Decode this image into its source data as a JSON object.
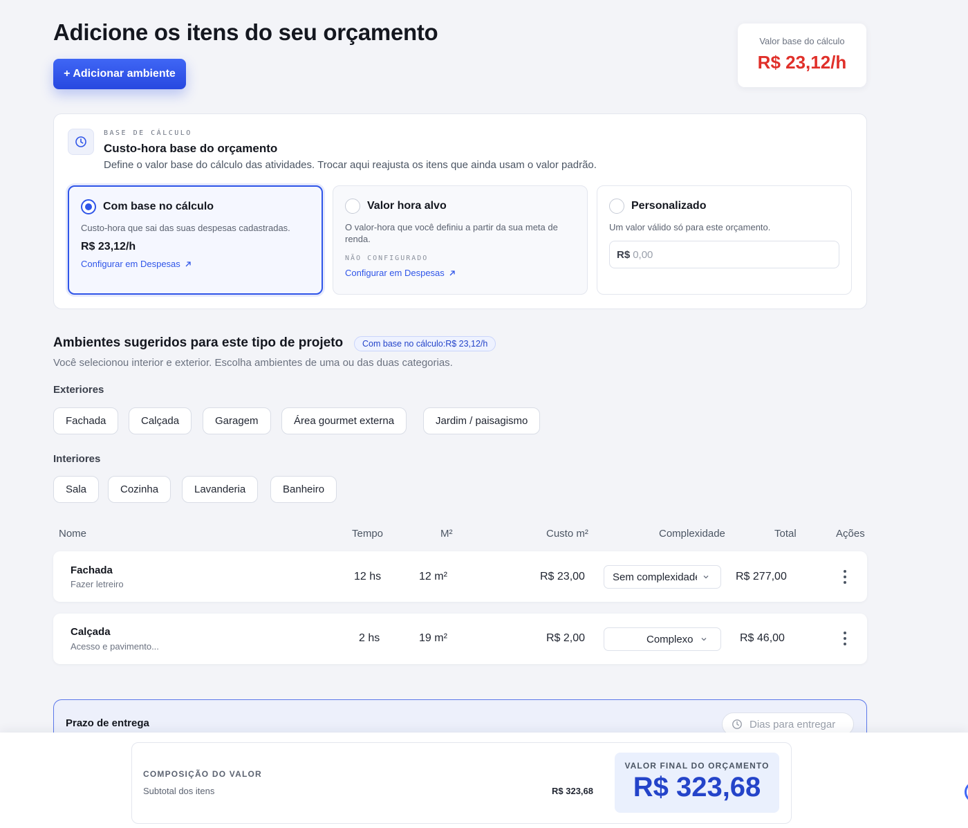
{
  "header": {
    "title": "Adicione os itens do seu orçamento",
    "add_button": "+ Adicionar ambiente",
    "base_card": {
      "label": "Valor base do cálculo",
      "value": "R$ 23,12/h"
    }
  },
  "calc_panel": {
    "eyebrow": "BASE DE CÁLCULO",
    "title": "Custo-hora base do orçamento",
    "description": "Define o valor base do cálculo das atividades. Trocar aqui reajusta os itens que ainda usam o valor padrão.",
    "options": [
      {
        "title": "Com base no cálculo",
        "description": "Custo-hora que sai das suas despesas cadastradas.",
        "price": "R$ 23,12/h",
        "link": "Configurar em Despesas",
        "selected": true
      },
      {
        "title": "Valor hora alvo",
        "description": "O valor-hora que você definiu a partir da sua meta de renda.",
        "status": "NÃO CONFIGURADO",
        "link": "Configurar em Despesas",
        "selected": false
      },
      {
        "title": "Personalizado",
        "description": "Um valor válido só para este orçamento.",
        "input_prefix": "R$",
        "input_placeholder": "0,00",
        "selected": false
      }
    ]
  },
  "suggestions": {
    "title": "Ambientes sugeridos para este tipo de projeto",
    "badge": "Com base no cálculo:R$ 23,12/h",
    "description": "Você selecionou interior e exterior. Escolha ambientes de uma ou das duas categorias.",
    "exterior_label": "Exteriores",
    "exterior": [
      "Fachada",
      "Calçada",
      "Garagem",
      "Área gourmet externa",
      "Jardim / paisagismo"
    ],
    "interior_label": "Interiores",
    "interior": [
      "Sala",
      "Cozinha",
      "Lavanderia",
      "Banheiro"
    ]
  },
  "table": {
    "headers": {
      "name": "Nome",
      "time": "Tempo",
      "area": "M²",
      "cost": "Custo m²",
      "complexity": "Complexidade",
      "total": "Total",
      "actions": "Ações"
    },
    "rows": [
      {
        "name": "Fachada",
        "sub": "Fazer letreiro",
        "time": "12 hs",
        "area": "12 m²",
        "cost": "R$ 23,00",
        "complexity": "Sem complexidade",
        "total": "R$ 277,00"
      },
      {
        "name": "Calçada",
        "sub": "Acesso e pavimento...",
        "time": "2 hs",
        "area": "19 m²",
        "cost": "R$ 2,00",
        "complexity": "Complexo",
        "total": "R$ 46,00"
      }
    ]
  },
  "prazo": {
    "label": "Prazo de entrega",
    "placeholder": "Dias para entregar"
  },
  "summary": {
    "eyebrow": "COMPOSIÇÃO DO VALOR",
    "subtotal_label": "Subtotal dos itens",
    "subtotal_value": "R$ 323,68",
    "final_label": "VALOR FINAL DO ORÇAMENTO",
    "final_value": "R$ 323,68"
  },
  "colors": {
    "accent": "#2f55e8",
    "base_value": "#e0302a",
    "final_value": "#2444c9"
  }
}
